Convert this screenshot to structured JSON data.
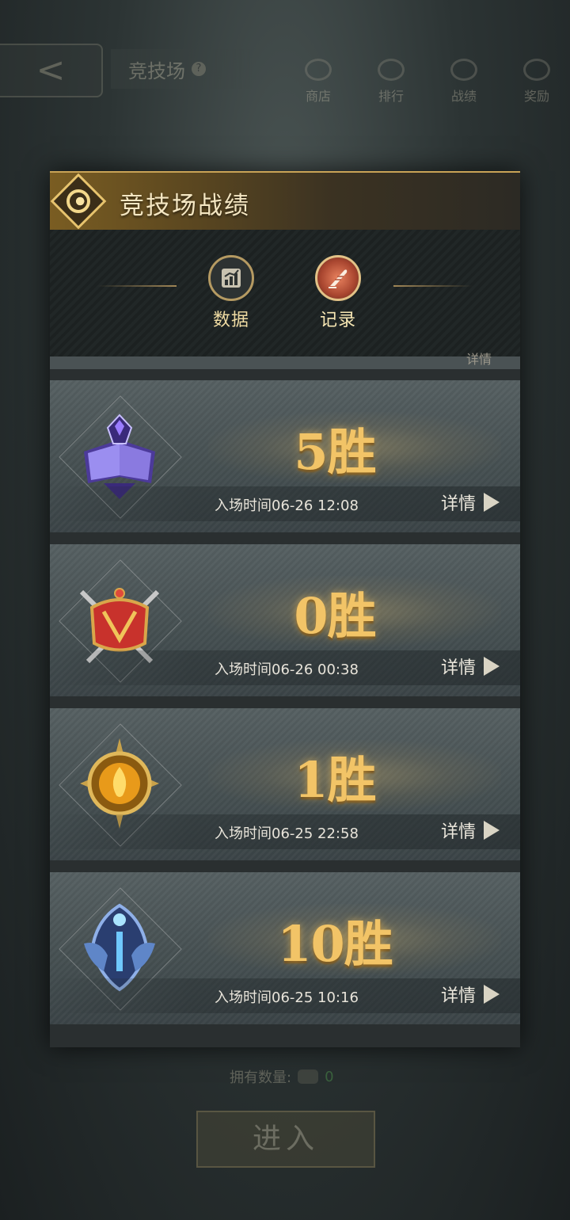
{
  "background": {
    "back_glyph": "<",
    "title": "竞技场",
    "help_glyph": "?",
    "nav": [
      {
        "label": "商店",
        "icon": "shop-icon"
      },
      {
        "label": "排行",
        "icon": "trophy-icon"
      },
      {
        "label": "战绩",
        "icon": "crossed-swords-icon"
      },
      {
        "label": "奖励",
        "icon": "reward-icon"
      }
    ],
    "count_label": "拥有数量:",
    "count_value": "0",
    "enter_label": "进入"
  },
  "panel": {
    "title": "竞技场战绩",
    "tabs": [
      {
        "label": "数据",
        "icon": "chart-icon",
        "active": false
      },
      {
        "label": "记录",
        "icon": "quill-icon",
        "active": true
      }
    ],
    "peek_text": "详情",
    "records": [
      {
        "wins": "5胜",
        "time": "入场时间06-26 12:08",
        "detail": "详情",
        "emblem": "spellbook-emblem-icon",
        "colors": [
          "#8a7ae0",
          "#4c3a9a"
        ]
      },
      {
        "wins": "0胜",
        "time": "入场时间06-26 00:38",
        "detail": "详情",
        "emblem": "crown-swords-emblem-icon",
        "colors": [
          "#c8322c",
          "#7a1a16"
        ]
      },
      {
        "wins": "1胜",
        "time": "入场时间06-25 22:58",
        "detail": "详情",
        "emblem": "flame-star-emblem-icon",
        "colors": [
          "#e89a1a",
          "#8a5a10"
        ]
      },
      {
        "wins": "10胜",
        "time": "入场时间06-25 10:16",
        "detail": "详情",
        "emblem": "sapphire-crest-emblem-icon",
        "colors": [
          "#5f86c8",
          "#2a3e70"
        ]
      }
    ]
  }
}
